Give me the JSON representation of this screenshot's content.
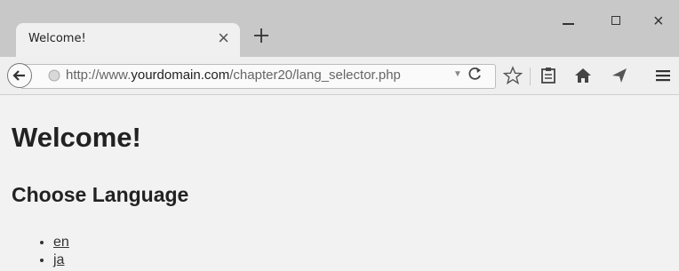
{
  "browser": {
    "tab_title": "Welcome!",
    "tab_close": "×",
    "close_glyph": "×",
    "url_prefix": "http://www.",
    "url_domain": "yourdomain.com",
    "url_path": "/chapter20/lang_selector.php",
    "dropdown_glyph": "▼"
  },
  "page": {
    "heading": "Welcome!",
    "subheading": "Choose Language",
    "languages": [
      "en",
      "ja"
    ]
  }
}
